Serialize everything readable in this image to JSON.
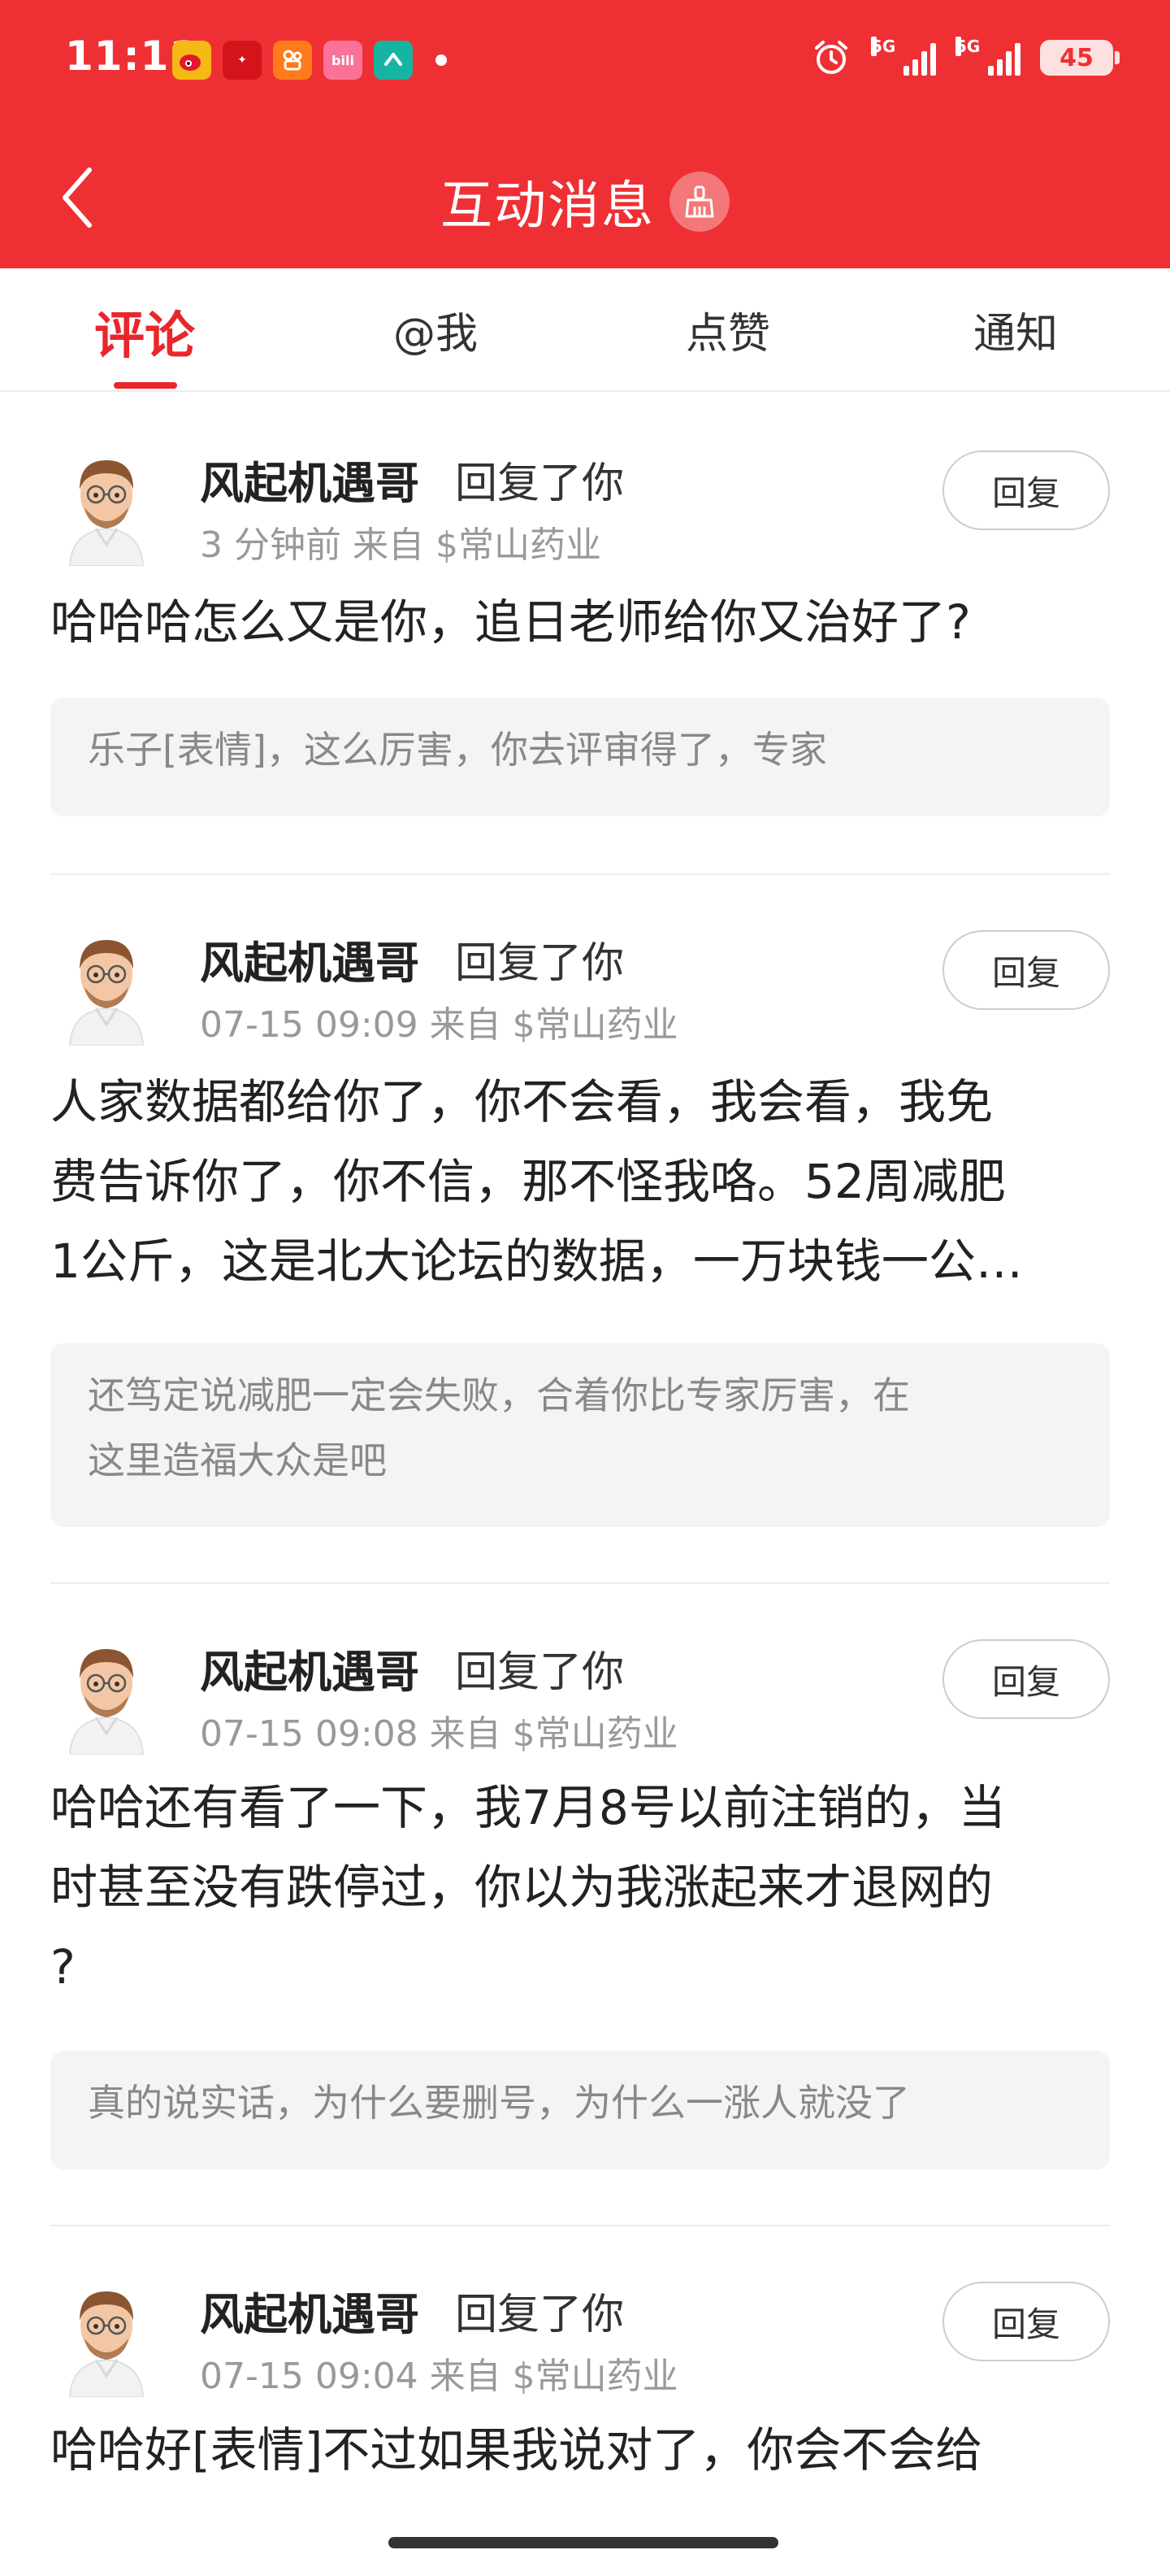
{
  "status_bar": {
    "time": "11:11",
    "battery": "45",
    "signal_1_label": "5G",
    "signal_2_label": "5G"
  },
  "header": {
    "title": "互动消息",
    "back_icon": "chevron-left-icon",
    "clear_icon": "broom-icon"
  },
  "tabs": [
    {
      "label": "评论",
      "active": true
    },
    {
      "label": "@我",
      "active": false
    },
    {
      "label": "点赞",
      "active": false
    },
    {
      "label": "通知",
      "active": false
    }
  ],
  "comments": [
    {
      "username": "风起机遇哥",
      "action": "回复了你",
      "meta": "3 分钟前 来自 $常山药业",
      "reply_label": "回复",
      "text": "哈哈哈怎么又是你，追日老师给你又治好了?",
      "quote": "乐子[表情]，这么厉害，你去评审得了，专家"
    },
    {
      "username": "风起机遇哥",
      "action": "回复了你",
      "meta": "07-15 09:09 来自 $常山药业",
      "reply_label": "回复",
      "text_lines": [
        "人家数据都给你了，你不会看，我会看，我免",
        "费告诉你了，你不信，那不怪我咯。52周减肥",
        "1公斤，这是北大论坛的数据，一万块钱一公…"
      ],
      "quote_lines": [
        "还笃定说减肥一定会失败，合着你比专家厉害，在",
        "这里造福大众是吧"
      ]
    },
    {
      "username": "风起机遇哥",
      "action": "回复了你",
      "meta": "07-15 09:08 来自 $常山药业",
      "reply_label": "回复",
      "text_lines": [
        "哈哈还有看了一下，我7月8号以前注销的，当",
        "时甚至没有跌停过，你以为我涨起来才退网的",
        "?"
      ],
      "quote": "真的说实话，为什么要删号，为什么一涨人就没了"
    },
    {
      "username": "风起机遇哥",
      "action": "回复了你",
      "meta": "07-15 09:04 来自 $常山药业",
      "reply_label": "回复",
      "text": "哈哈好[表情]不过如果我说对了，你会不会给"
    }
  ],
  "colors": {
    "brand_red": "#ee3034",
    "active_tab": "#e8272c",
    "muted_text": "#999999",
    "quote_bg": "#f4f4f4"
  }
}
